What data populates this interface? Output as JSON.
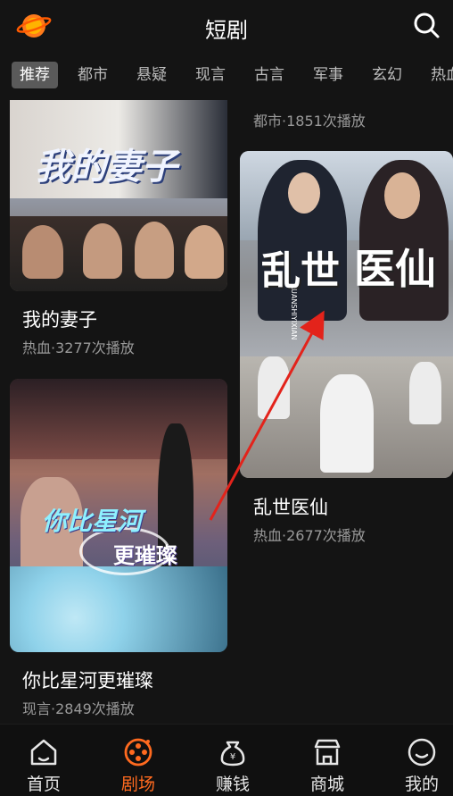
{
  "header": {
    "title": "短剧"
  },
  "tabs": [
    "推荐",
    "都市",
    "悬疑",
    "现言",
    "古言",
    "军事",
    "玄幻",
    "热血"
  ],
  "feed": {
    "top_right_meta": "都市·1851次播放",
    "left": [
      {
        "title": "我的妻子",
        "meta": "热血·3277次播放",
        "poster_text": "我的妻子"
      },
      {
        "title": "你比星河更璀璨",
        "meta": "现言·2849次播放",
        "poster_text_1": "你比星河",
        "poster_text_2": "更璀璨"
      }
    ],
    "right": [
      {
        "title": "乱世医仙",
        "meta": "热血·2677次播放",
        "poster_text_1": "乱世",
        "poster_text_2": "医仙",
        "poster_small": "LUANSHIYIXIAN"
      }
    ]
  },
  "nav": [
    {
      "label": "首页",
      "icon": "home-icon"
    },
    {
      "label": "剧场",
      "icon": "film-reel-icon"
    },
    {
      "label": "赚钱",
      "icon": "money-bag-icon"
    },
    {
      "label": "商城",
      "icon": "store-icon"
    },
    {
      "label": "我的",
      "icon": "smile-icon"
    }
  ],
  "colors": {
    "accent": "#ff6a1f",
    "background": "#141414"
  }
}
